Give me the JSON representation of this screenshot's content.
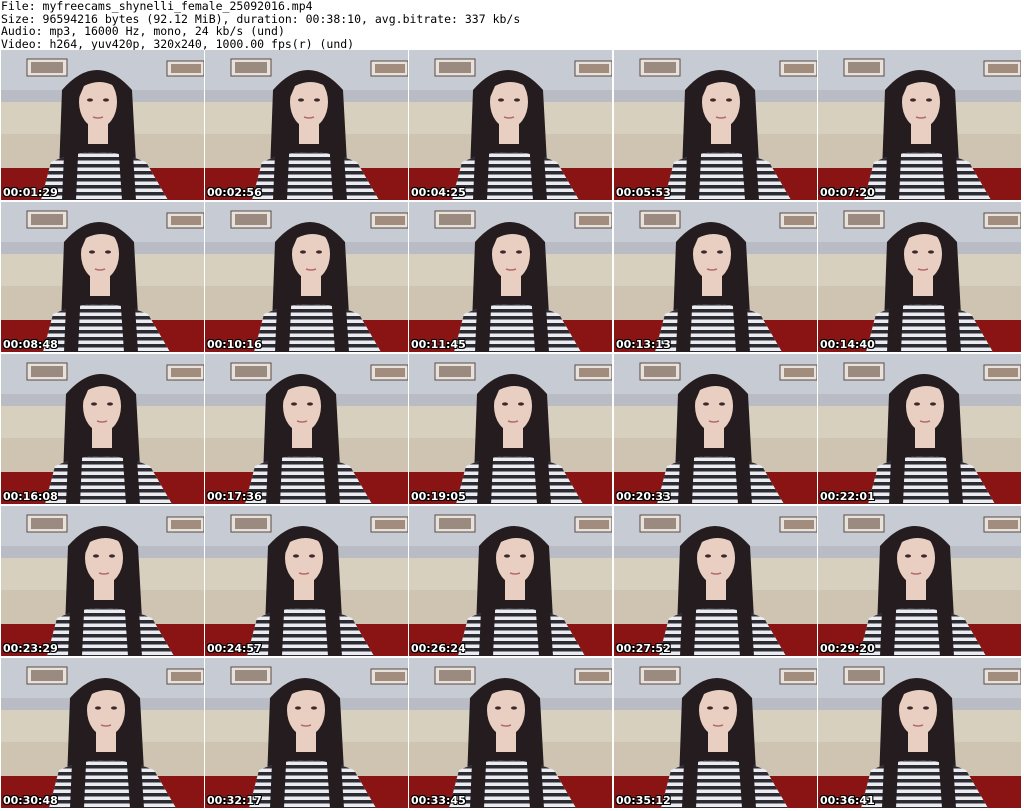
{
  "header": {
    "file_line": "File: myfreecams_shynelli_female_25092016.mp4",
    "size_line": "Size: 96594216 bytes (92.12 MiB), duration: 00:38:10, avg.bitrate: 337 kb/s",
    "audio_line": "Audio: mp3, 16000 Hz, mono, 24 kb/s (und)",
    "video_line": "Video: h264, yuv420p, 320x240, 1000.00 fps(r) (und)"
  },
  "thumbnails": [
    {
      "timestamp": "00:01:29"
    },
    {
      "timestamp": "00:02:56"
    },
    {
      "timestamp": "00:04:25"
    },
    {
      "timestamp": "00:05:53"
    },
    {
      "timestamp": "00:07:20"
    },
    {
      "timestamp": "00:08:48"
    },
    {
      "timestamp": "00:10:16"
    },
    {
      "timestamp": "00:11:45"
    },
    {
      "timestamp": "00:13:13"
    },
    {
      "timestamp": "00:14:40"
    },
    {
      "timestamp": "00:16:08"
    },
    {
      "timestamp": "00:17:36"
    },
    {
      "timestamp": "00:19:05"
    },
    {
      "timestamp": "00:20:33"
    },
    {
      "timestamp": "00:22:01"
    },
    {
      "timestamp": "00:23:29"
    },
    {
      "timestamp": "00:24:57"
    },
    {
      "timestamp": "00:26:24"
    },
    {
      "timestamp": "00:27:52"
    },
    {
      "timestamp": "00:29:20"
    },
    {
      "timestamp": "00:30:48"
    },
    {
      "timestamp": "00:32:17"
    },
    {
      "timestamp": "00:33:45"
    },
    {
      "timestamp": "00:35:12"
    },
    {
      "timestamp": "00:36:41"
    }
  ],
  "colors": {
    "wall": "#b9bcc4",
    "sofa": "#d8d0bf",
    "red": "#8a1414",
    "hair": "#241c1e",
    "skin": "#e9cfc1",
    "stripe_dark": "#2b2b33",
    "stripe_light": "#ecebf0"
  }
}
